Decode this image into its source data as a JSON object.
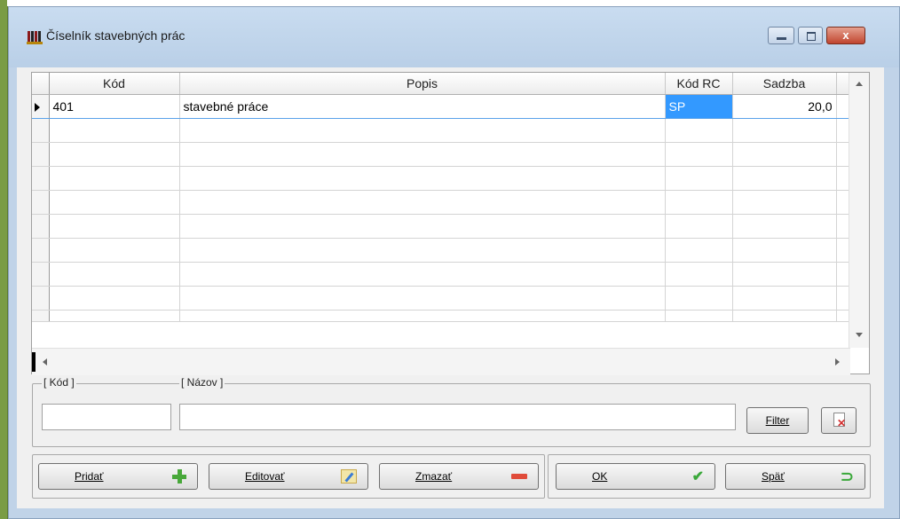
{
  "window": {
    "title": "Číselník stavebných prác",
    "close_glyph": "x"
  },
  "grid": {
    "columns": [
      "Kód",
      "Popis",
      "Kód RC",
      "Sadzba"
    ],
    "rows": [
      {
        "kod": "401",
        "popis": "stavebné práce",
        "kod_rc": "SP",
        "sadzba": "20,0"
      }
    ],
    "empty_row_count": 9
  },
  "filter": {
    "kod_label": "[ Kód ]",
    "nazov_label": "[ Názov ]",
    "kod_value": "",
    "nazov_value": "",
    "filter_button": "Filter"
  },
  "actions": {
    "pridat": "Pridať",
    "editovat": "Editovať",
    "zmazat": "Zmazať",
    "ok": "OK",
    "spat": "Späť"
  },
  "icons": {
    "app": "grid-app-icon",
    "pridat": "plus-icon",
    "editovat": "edit-icon",
    "zmazat": "minus-icon",
    "ok": "check-icon",
    "spat": "back-arrow-icon",
    "filter_clear": "clear-filter-icon"
  },
  "colors": {
    "selection": "#3399ff",
    "accent_green": "#48a83a",
    "accent_red": "#e04b3a",
    "title_bg": "#c9dcf0"
  }
}
